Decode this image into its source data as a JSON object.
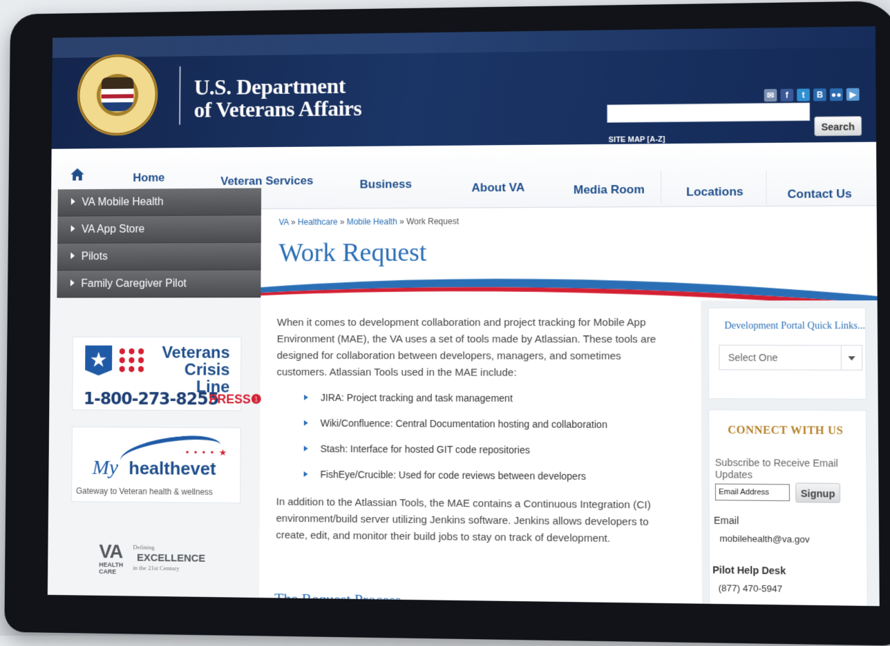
{
  "header": {
    "title_line1": "U.S. Department",
    "title_line2": "of Veterans Affairs",
    "search_placeholder": "",
    "search_button": "Search",
    "site_map": "SITE MAP [A-Z]",
    "social": [
      {
        "icon": "email-icon",
        "glyph": "✉",
        "color": "#7b8fb0"
      },
      {
        "icon": "facebook-icon",
        "glyph": "f",
        "color": "#3b5998"
      },
      {
        "icon": "twitter-icon",
        "glyph": "t",
        "color": "#2f8fd1"
      },
      {
        "icon": "blog-icon",
        "glyph": "B",
        "color": "#2b6cb0"
      },
      {
        "icon": "flickr-icon",
        "glyph": "●●",
        "color": "#2b6cb0"
      },
      {
        "icon": "youtube-icon",
        "glyph": "▶",
        "color": "#5b9bd5"
      }
    ]
  },
  "nav": {
    "items": [
      "Home",
      "Veteran Services",
      "Business",
      "About VA",
      "Media Room",
      "Locations",
      "Contact Us"
    ]
  },
  "sidebar": {
    "items": [
      "VA Mobile Health",
      "VA App Store",
      "Pilots",
      "Family Caregiver Pilot"
    ],
    "crisis": {
      "title_line1": "Veterans",
      "title_line2": "Crisis Line",
      "phone": "1-800-273-8255",
      "press": "PRESS❶"
    },
    "mhv": {
      "my": "My",
      "health": "healthevet",
      "tagline": "Gateway to Veteran health & wellness"
    },
    "vahc": {
      "va": "VA",
      "health_care": "HEALTH CARE",
      "defining": "Defining",
      "excellence": "EXCELLENCE",
      "century": "in the 21st Century"
    }
  },
  "main": {
    "breadcrumb": {
      "va": "VA",
      "healthcare": "Healthcare",
      "mobile": "Mobile Health",
      "current": "Work Request",
      "sep": " » "
    },
    "title": "Work Request",
    "intro": "When it comes to development collaboration and project tracking for Mobile App Environment (MAE), the VA uses a set of tools made by Atlassian. These tools are designed for collaboration between developers, managers, and sometimes customers. Atlassian Tools used in the MAE include:",
    "bullets": [
      "JIRA: Project tracking and task management",
      "Wiki/Confluence: Central Documentation hosting and collaboration",
      "Stash: Interface for hosted GIT code repositories",
      "FishEye/Crucible: Used for code reviews between developers"
    ],
    "ci_paragraph": "In addition to the Atlassian Tools, the MAE contains a Continuous Integration (CI) environment/build server utilizing Jenkins software. Jenkins allows developers to create, edit, and monitor their build jobs to stay on track of development.",
    "subheading": "The Request Process"
  },
  "right": {
    "quicklinks_title": "Development Portal Quick Links...",
    "select_value": "Select One",
    "connect_title": "CONNECT WITH US",
    "subscribe_label": "Subscribe to Receive Email Updates",
    "email_placeholder": "Email Address",
    "signup": "Signup",
    "email_label": "Email",
    "email_value": "mobilehealth@va.gov",
    "help_label": "Pilot Help Desk",
    "help_value": "(877) 470-5947"
  },
  "colors": {
    "header": "#13254d",
    "link": "#2a6fb6",
    "accent": "#b8822a",
    "crisis_red": "#d42033"
  }
}
